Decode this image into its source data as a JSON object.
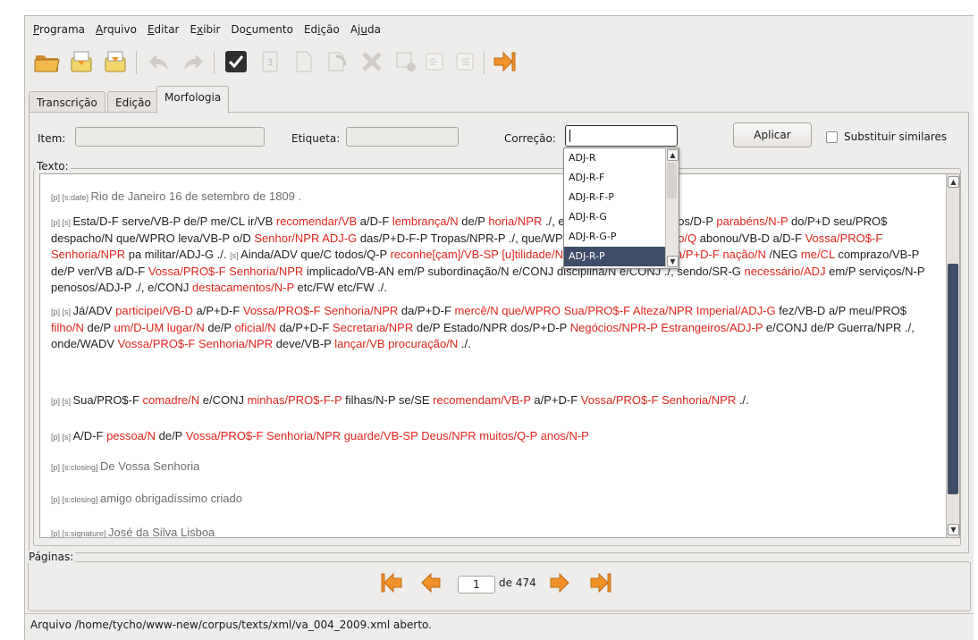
{
  "menu": [
    {
      "pre": "",
      "u": "P",
      "post": "rograma"
    },
    {
      "pre": "",
      "u": "A",
      "post": "rquivo"
    },
    {
      "pre": "",
      "u": "E",
      "post": "ditar"
    },
    {
      "pre": "E",
      "u": "x",
      "post": "ibir"
    },
    {
      "pre": "Do",
      "u": "c",
      "post": "umento"
    },
    {
      "pre": "Ed",
      "u": "i",
      "post": "ção"
    },
    {
      "pre": "Aj",
      "u": "u",
      "post": "da"
    }
  ],
  "tabs": [
    "Transcrição",
    "Edição",
    "Morfologia"
  ],
  "active_tab": "Morfologia",
  "form": {
    "item_label": "Item:",
    "item_value": "",
    "etiqueta_label": "Etiqueta:",
    "etiqueta_value": "",
    "correcao_label": "Correção:",
    "correcao_value": "",
    "apply_label": "Aplicar",
    "replace_similar_label": "Substituir similares"
  },
  "dropdown": {
    "options": [
      "ADJ-R",
      "ADJ-R-F",
      "ADJ-R-F-P",
      "ADJ-R-G",
      "ADJ-R-G-P",
      "ADJ-R-P"
    ],
    "selected": "ADJ-R-P"
  },
  "text_group_title": "Texto:",
  "pages_group_title": "Páginas:",
  "pagination": {
    "current": "1",
    "of_label": "de 474"
  },
  "status": "Arquivo /home/tycho/www-new/corpus/texts/xml/va_004_2009.xml aberto.",
  "colors": {
    "highlight": "#e0261d",
    "selection": "#3e4d68",
    "arrow_orange": "#f0922a"
  },
  "paragraphs": [
    [
      {
        "t": "[p] [s:date] ",
        "c": "tag"
      },
      {
        "t": "Rio de Janeiro 16 de setembro de 1809 .",
        "c": "meta"
      }
    ],
    [
      {
        "t": "[p] [s] ",
        "c": "tag"
      },
      {
        "t": "Esta/D-F serve/VB-P de/P me/CL ir/VB "
      },
      {
        "t": "recomendar/VB",
        "c": "hl"
      },
      {
        "t": " a/D-F "
      },
      {
        "t": "lembrança/N",
        "c": "hl"
      },
      {
        "t": " de/P ",
        "c": ""
      },
      {
        "t": "                                                ",
        "c": ""
      },
      {
        "t": "horia/NPR",
        "c": "hl"
      },
      {
        "t": " ./, e/CONJ dar/VB lhe/CL os/D-P "
      },
      {
        "t": "parabéns/N-P",
        "c": "hl"
      },
      {
        "t": " do/P+D seu/PRO$ despacho/N que/WPRO leva/VB-P o/D "
      },
      {
        "t": "Senhor/NPR",
        "c": "hl"
      },
      {
        "t": "                                   "
      },
      {
        "t": "ADJ-G",
        "c": "hl"
      },
      {
        "t": " das/P+D-F-P Tropas/NPR-P ./, que/WPRO "
      },
      {
        "t": "também/ADV muito/Q",
        "c": "hl"
      },
      {
        "t": " abonou/VB-D a/D-F "
      },
      {
        "t": "Vossa/PRO$-F Senhoria/NPR",
        "c": "hl"
      },
      {
        "t": " pa                                            militar/ADJ-G ./. "
      },
      {
        "t": "[s] ",
        "c": "tag"
      },
      {
        "t": "Ainda/ADV que/C todos/Q-P "
      },
      {
        "t": "reconhe[çam]/VB-SP [u]tilidade/N",
        "c": "hl"
      },
      {
        "t": " deste/P+D serviço/N "
      },
      {
        "t": "à/P+D-F nação/N",
        "c": "hl"
      },
      {
        "t": "                              /NEG "
      },
      {
        "t": "me/CL",
        "c": "hl"
      },
      {
        "t": " comprazo/VB-P de/P ver/VB a/D-F "
      },
      {
        "t": "Vossa/PRO$-F Senhoria/NPR",
        "c": "hl"
      },
      {
        "t": " implicado/VB-AN em/P subordinação/N e/CONJ disciplina/N e/CONJ ./, sendo/SR-G "
      },
      {
        "t": "necessário/ADJ",
        "c": "hl"
      },
      {
        "t": " em/P serviços/N-P penosos/ADJ-P ./, e/CONJ "
      },
      {
        "t": "destacamentos/N-P",
        "c": "hl"
      },
      {
        "t": " etc/FW etc/FW ./."
      }
    ],
    [
      {
        "t": "[p] [s] ",
        "c": "tag"
      },
      {
        "t": "Já/ADV "
      },
      {
        "t": "participei/VB-D",
        "c": "hl"
      },
      {
        "t": " a/P+D-F "
      },
      {
        "t": "Vossa/PRO$-F Senhoria/NPR",
        "c": "hl"
      },
      {
        "t": " da/P+D-F "
      },
      {
        "t": "mercê/N que/WPRO Sua/PRO$-F Alteza/NPR Imperial/ADJ-G",
        "c": "hl"
      },
      {
        "t": " fez/VB-D a/P meu/PRO$ "
      },
      {
        "t": "filho/N",
        "c": "hl"
      },
      {
        "t": " de/P "
      },
      {
        "t": "um/D-UM lugar/N",
        "c": "hl"
      },
      {
        "t": " de/P "
      },
      {
        "t": "oficial/N",
        "c": "hl"
      },
      {
        "t": " da/P+D-F "
      },
      {
        "t": "Secretaria/NPR",
        "c": "hl"
      },
      {
        "t": " de/P Estado/NPR dos/P+D-P "
      },
      {
        "t": "Negócios/NPR-P Estrangeiros/ADJ-P",
        "c": "hl"
      },
      {
        "t": " e/CONJ de/P Guerra/NPR ./, onde/WADV "
      },
      {
        "t": "Vossa/PRO$-F Senhoria/NPR",
        "c": "hl"
      },
      {
        "t": " deve/VB-P "
      },
      {
        "t": "lançar/VB procuração/N",
        "c": "hl"
      },
      {
        "t": " ./."
      }
    ],
    [
      {
        "t": "[p] [s] ",
        "c": "tag"
      },
      {
        "t": "Sua/PRO$-F "
      },
      {
        "t": "comadre/N",
        "c": "hl"
      },
      {
        "t": " e/CONJ "
      },
      {
        "t": "minhas/PRO$-F-P",
        "c": "hl"
      },
      {
        "t": " filhas/N-P se/SE "
      },
      {
        "t": "recomendam/VB-P",
        "c": "hl"
      },
      {
        "t": " a/P+D-F "
      },
      {
        "t": "Vossa/PRO$-F Senhoria/NPR",
        "c": "hl"
      },
      {
        "t": " ./."
      }
    ],
    [
      {
        "t": "[p] [s] ",
        "c": "tag"
      },
      {
        "t": "A/D-F "
      },
      {
        "t": "pessoa/N",
        "c": "hl"
      },
      {
        "t": " de/P "
      },
      {
        "t": "Vossa/PRO$-F Senhoria/NPR guarde/VB-SP Deus/NPR muitos/Q-P anos/N-P",
        "c": "hl"
      }
    ],
    [
      {
        "t": "[p] [s:closing] ",
        "c": "tag"
      },
      {
        "t": "De Vossa Senhoria",
        "c": "meta"
      }
    ],
    [
      {
        "t": "[p] [s:closing] ",
        "c": "tag"
      },
      {
        "t": "amigo obrigadíssimo criado",
        "c": "meta"
      }
    ],
    [
      {
        "t": "[p] [s:signature] ",
        "c": "tag"
      },
      {
        "t": "José da Silva Lisboa",
        "c": "meta"
      }
    ]
  ]
}
